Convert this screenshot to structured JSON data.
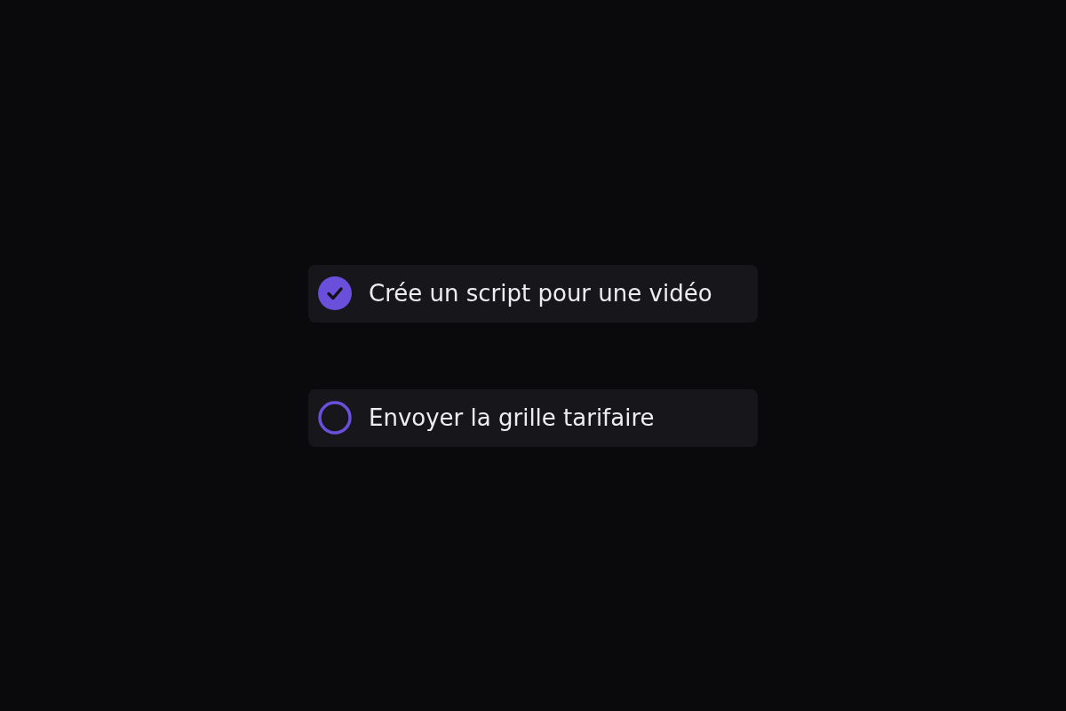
{
  "tasks": [
    {
      "label": "Crée un script pour une vidéo",
      "checked": true
    },
    {
      "label": "Envoyer la grille tarifaire",
      "checked": false
    }
  ]
}
